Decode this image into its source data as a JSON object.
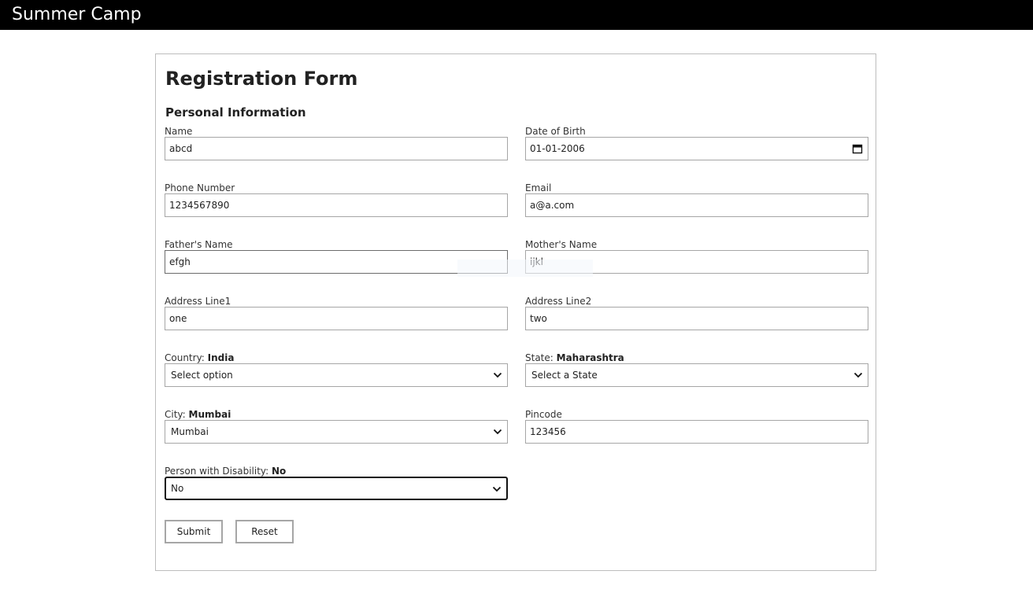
{
  "header": {
    "brand": "Summer Camp"
  },
  "form": {
    "title": "Registration Form",
    "section": "Personal Information",
    "name": {
      "label": "Name",
      "value": "abcd"
    },
    "dob": {
      "label": "Date of Birth",
      "value": "01-01-2006"
    },
    "phone": {
      "label": "Phone Number",
      "value": "1234567890"
    },
    "email": {
      "label": "Email",
      "value": "a@a.com"
    },
    "father": {
      "label": "Father's Name",
      "value": "efgh"
    },
    "mother": {
      "label": "Mother's Name",
      "value": "ijkl"
    },
    "address1": {
      "label": "Address Line1",
      "value": "one"
    },
    "address2": {
      "label": "Address Line2",
      "value": "two"
    },
    "country": {
      "label": "Country:",
      "selected_display": "India",
      "value": "Select option"
    },
    "state": {
      "label": "State:",
      "selected_display": "Maharashtra",
      "value": "Select a State"
    },
    "city": {
      "label": "City:",
      "selected_display": "Mumbai",
      "value": "Mumbai"
    },
    "pincode": {
      "label": "Pincode",
      "value": "123456"
    },
    "disability": {
      "label": "Person with Disability:",
      "selected_display": "No",
      "value": "No"
    },
    "submit_label": "Submit",
    "reset_label": "Reset"
  },
  "icons": {
    "calendar": "calendar-icon",
    "dropdown": "chevron-down-icon"
  }
}
